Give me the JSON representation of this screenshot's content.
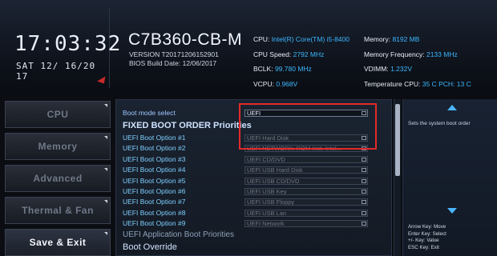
{
  "clock": {
    "time": "17:03:32",
    "date": "SAT 12/ 16/20 17"
  },
  "model": {
    "name": "C7B360-CB-M",
    "version": "VERSION T20171206152901",
    "bios_build": "BIOS Build Date: 12/06/2017"
  },
  "sysinfo_left": [
    {
      "k": "CPU:",
      "v": "Intel(R) Core(TM) i5-8400"
    },
    {
      "k": "CPU Speed:",
      "v": "2792 MHz"
    },
    {
      "k": "BCLK:",
      "v": "99.780 MHz"
    },
    {
      "k": "VCPU:",
      "v": "0.968V"
    }
  ],
  "sysinfo_right": [
    {
      "k": "Memory:",
      "v": "8192 MB"
    },
    {
      "k": "Memory Frequency:",
      "v": "2133 MHz"
    },
    {
      "k": "VDIMM:",
      "v": "1.232V"
    },
    {
      "k": "Temperature CPU:",
      "v": "35 C PCH: 13 C"
    }
  ],
  "nav": [
    {
      "label": "CPU",
      "active": false
    },
    {
      "label": "Memory",
      "active": false
    },
    {
      "label": "Advanced",
      "active": false
    },
    {
      "label": "Thermal & Fan",
      "active": false
    },
    {
      "label": "Save & Exit",
      "active": true
    }
  ],
  "main": {
    "boot_mode_label": "Boot mode select",
    "boot_mode_value": "UEFI",
    "fixed_heading": "FIXED BOOT ORDER Priorities",
    "options": [
      {
        "label": "UEFI Boot Option #1",
        "value": "UEFI Hard Disk"
      },
      {
        "label": "UEFI Boot Option #2",
        "value": "UEFI NETWORK: ROM Inst. Intel..."
      },
      {
        "label": "UEFI Boot Option #3",
        "value": "UEFI CD/DVD"
      },
      {
        "label": "UEFI Boot Option #4",
        "value": "UEFI USB Hard Disk"
      },
      {
        "label": "UEFI Boot Option #5",
        "value": "UEFI USB CD/DVD"
      },
      {
        "label": "UEFI Boot Option #6",
        "value": "UEFI USB Key"
      },
      {
        "label": "UEFI Boot Option #7",
        "value": "UEFI USB Floppy"
      },
      {
        "label": "UEFI Boot Option #8",
        "value": "UEFI USB Lan"
      },
      {
        "label": "UEFI Boot Option #9",
        "value": "UEFI Network"
      }
    ],
    "app_priorities": "UEFI Application Boot Priorities",
    "boot_override": "Boot Override"
  },
  "help": {
    "text": "Sets the system boot order",
    "keys": [
      "Arrow Key: Move",
      "Enter Key: Select",
      "+/- Key: Value",
      "ESC Key: Exit"
    ]
  },
  "colors": {
    "accent": "#3bb7ff",
    "highlight": "#e22a2a"
  }
}
